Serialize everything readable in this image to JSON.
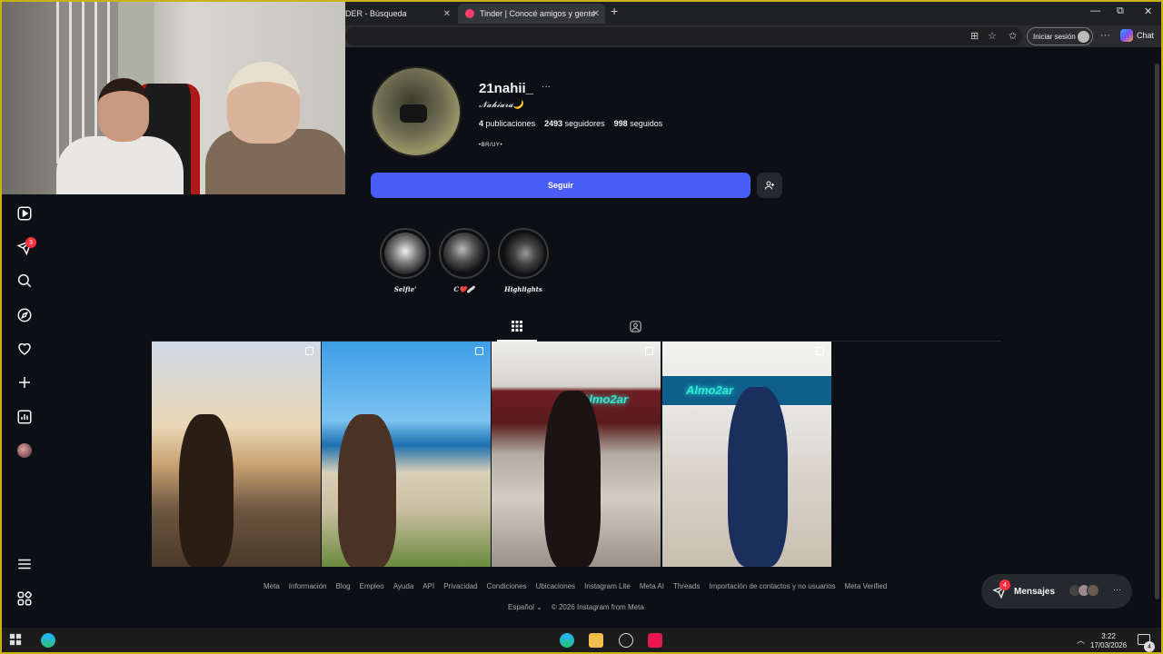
{
  "browser": {
    "tab1_title": "DER - Búsqueda",
    "tab2_title": "Tinder | Conocé amigos y gente n",
    "new_tab": "+",
    "signin_label": "Iniciar sesión",
    "chat_label": "Chat",
    "win_min": "—",
    "win_max": "⧉",
    "win_close": "✕"
  },
  "nav": {
    "messages_badge": "3"
  },
  "profile": {
    "username": "21nahii_",
    "more": "···",
    "fullname": "𝓝𝓪𝓱𝓲𝓪𝓻𝓪🌙",
    "posts_count": "4",
    "posts_label": "publicaciones",
    "followers_count": "2493",
    "followers_label": "seguidores",
    "following_count": "998",
    "following_label": "seguidos",
    "bio": "•BR/UY•",
    "follow_label": "Seguir"
  },
  "highlights": [
    {
      "label": "𝑺𝒆𝒍𝒇𝒊𝒆'"
    },
    {
      "label": "C❤️🩹"
    },
    {
      "label": "𝑯𝒊𝒈𝒉𝒍𝒊𝒈𝒉𝒕𝒔"
    }
  ],
  "posts": [
    {
      "neon": ""
    },
    {
      "neon": ""
    },
    {
      "neon": "Almo2ar"
    },
    {
      "neon": "Almo2ar"
    }
  ],
  "footer": {
    "links": [
      "Meta",
      "Información",
      "Blog",
      "Empleo",
      "Ayuda",
      "API",
      "Privacidad",
      "Condiciones",
      "Ubicaciones",
      "Instagram Lite",
      "Meta AI",
      "Threads",
      "Importación de contactos y no usuarios",
      "Meta Verified"
    ],
    "language": "Español",
    "copyright": "© 2026 Instagram from Meta"
  },
  "messages": {
    "label": "Mensajes",
    "badge": "4",
    "more": "···"
  },
  "taskbar": {
    "time": "3:22",
    "date": "17/03/2026",
    "notif_count": "4"
  },
  "colors": {
    "follow_button": "#4a5df9",
    "badge": "#ff3040",
    "background": "#0c1014"
  }
}
